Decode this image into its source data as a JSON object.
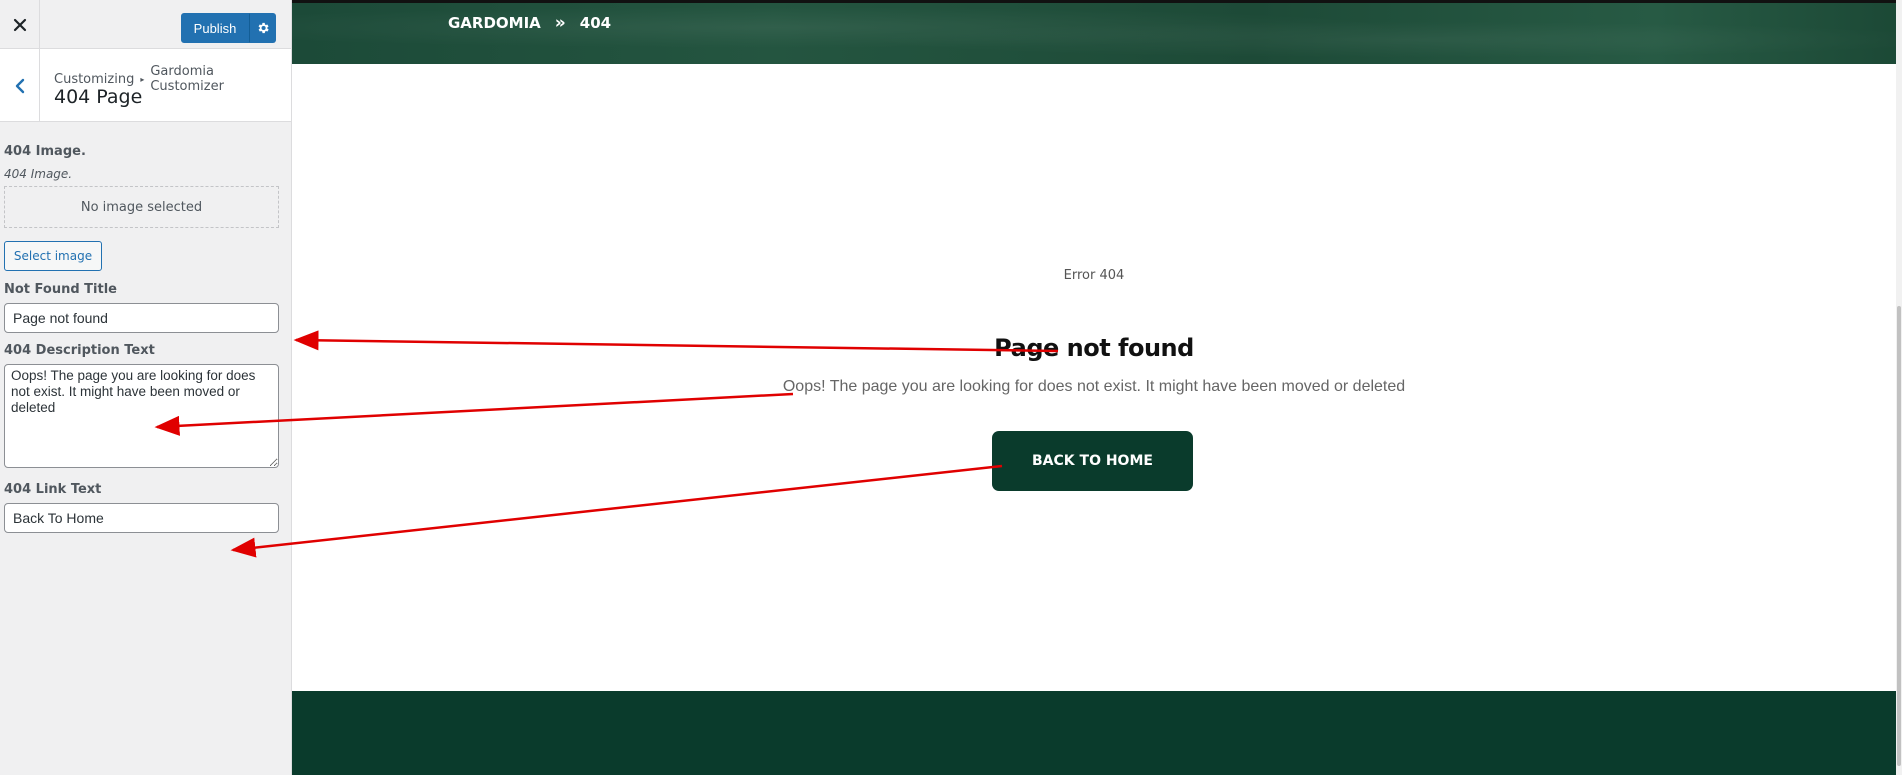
{
  "customizer": {
    "publish_label": "Publish",
    "breadcrumb_root": "Customizing",
    "breadcrumb_parent": "Gardomia Customizer",
    "section_title": "404 Page",
    "controls": {
      "image_label": "404 Image.",
      "image_description": "404 Image.",
      "image_placeholder": "No image selected",
      "select_image_label": "Select image",
      "title_label": "Not Found Title",
      "title_value": "Page not found",
      "description_label": "404 Description Text",
      "description_value": "Oops! The page you are looking for does not exist. It might have been moved or deleted",
      "link_label": "404 Link Text",
      "link_value": "Back To Home"
    }
  },
  "preview": {
    "breadcrumb_home": "GARDOMIA",
    "breadcrumb_separator": "»",
    "breadcrumb_current": "404",
    "error_code": "Error 404",
    "title": "Page not found",
    "description": "Oops! The page you are looking for does not exist. It might have been moved or deleted",
    "button_label": "BACK TO HOME"
  },
  "icons": {
    "close": "close-icon",
    "settings": "gear-icon",
    "back": "chevron-left-icon",
    "breadcrumb_arrow": "triangle-right-icon",
    "resize": "resize-handle-icon"
  },
  "colors": {
    "accent": "#2271b1",
    "brand_dark_green": "#0a3b2c",
    "annotation_arrow": "#e00000"
  }
}
